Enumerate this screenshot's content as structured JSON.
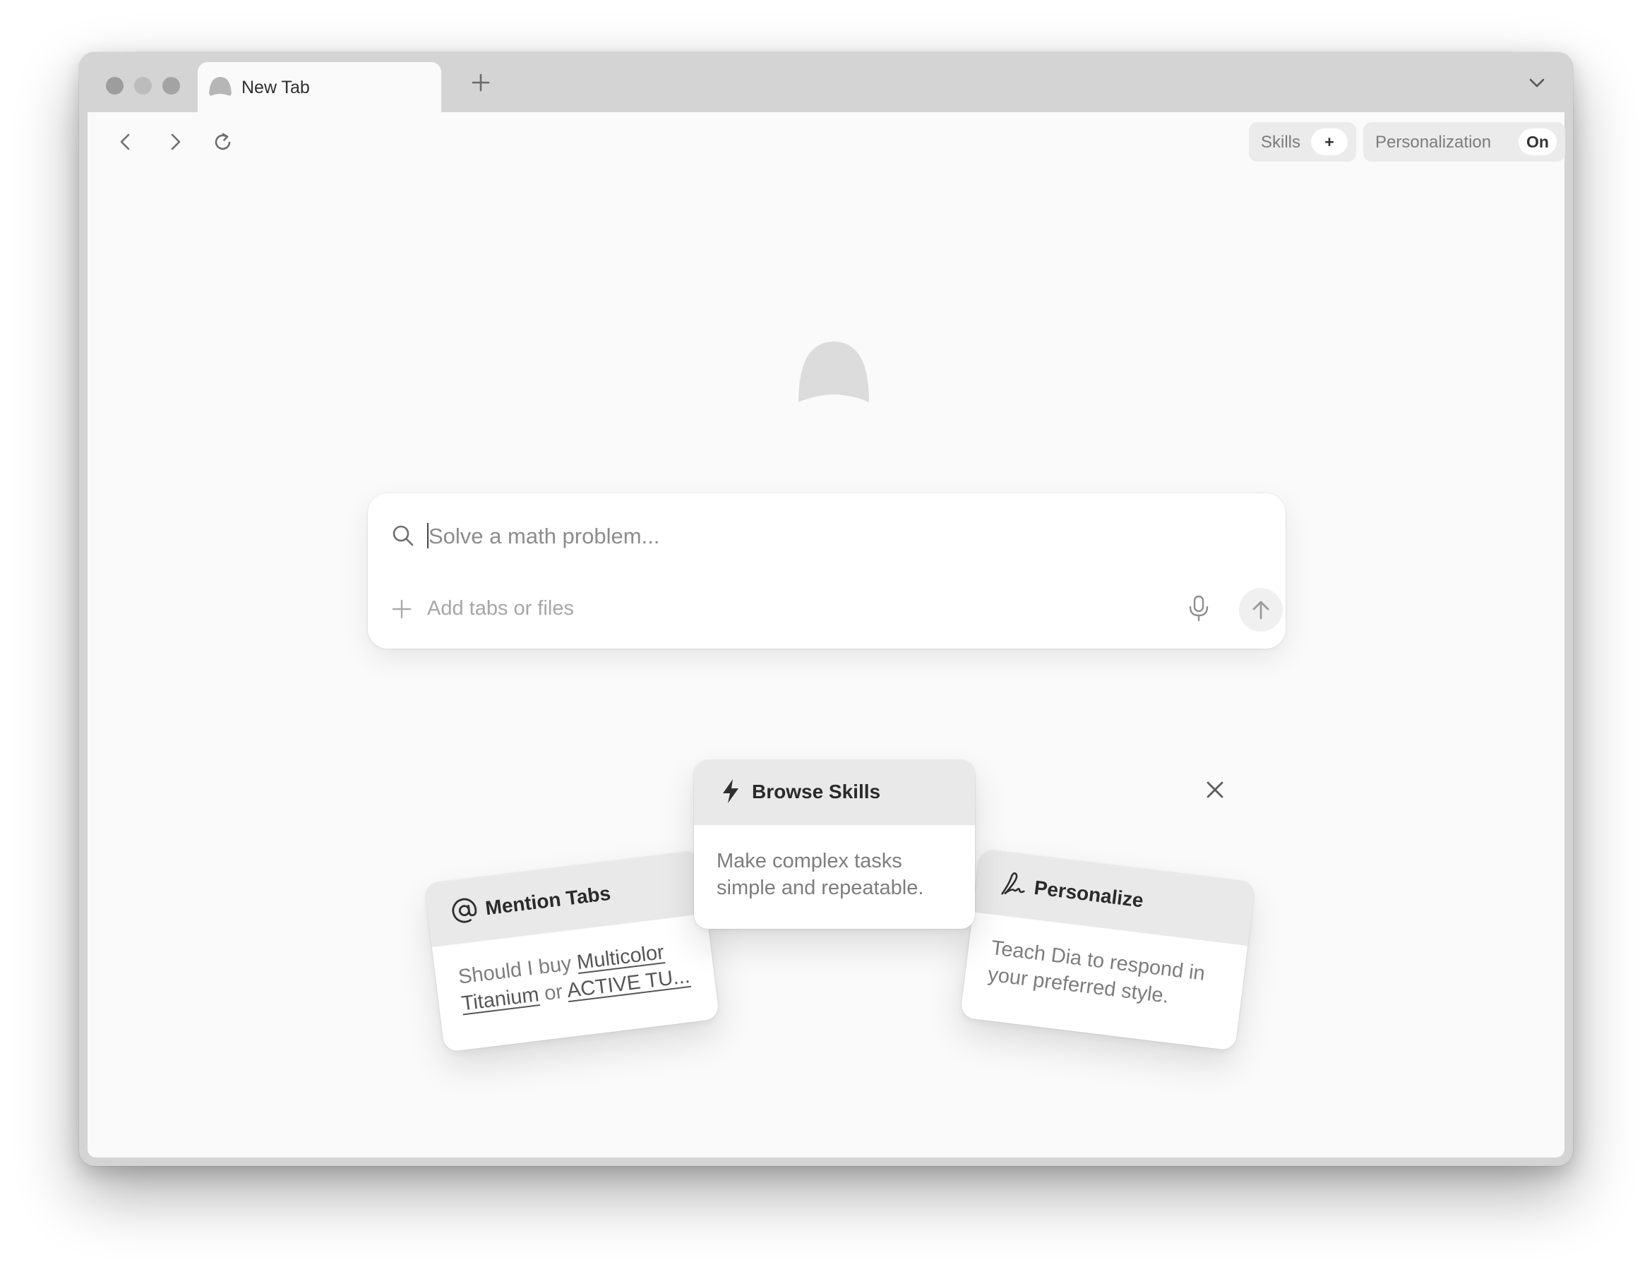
{
  "browser": {
    "tab": {
      "title": "New Tab"
    },
    "toolbar": {
      "skills": {
        "label": "Skills",
        "add": "+"
      },
      "personalization": {
        "label": "Personalization",
        "state": "On"
      }
    }
  },
  "search": {
    "placeholder": "Solve a math problem...",
    "add_label": "Add tabs or files"
  },
  "cards": {
    "mention": {
      "title": "Mention Tabs",
      "body_prefix": "Should I buy ",
      "link1": "Multicolor Titanium",
      "body_mid": " or ",
      "link2": "ACTIVE TU..."
    },
    "skills": {
      "title": "Browse Skills",
      "body": "Make complex tasks simple and repeatable."
    },
    "personalize": {
      "title": "Personalize",
      "body": "Teach Dia to respond in your preferred style."
    }
  },
  "colors": {
    "window_chrome": "#d4d4d4",
    "content_bg": "#fafafa",
    "card_header": "#e9e9e9",
    "text_primary": "#2a2a2a",
    "text_muted": "#7d7d7d"
  },
  "icons": {
    "tab": "dia-logo-icon",
    "new_tab": "plus-icon",
    "tab_overview": "chevron-down-icon",
    "back": "chevron-left-icon",
    "forward": "chevron-right-icon",
    "reload": "reload-icon",
    "search": "search-icon",
    "add": "plus-icon",
    "mic": "microphone-icon",
    "send": "arrow-up-icon",
    "close": "close-icon",
    "mention": "at-sign-icon",
    "skills": "lightning-icon",
    "personalize": "signature-icon"
  }
}
